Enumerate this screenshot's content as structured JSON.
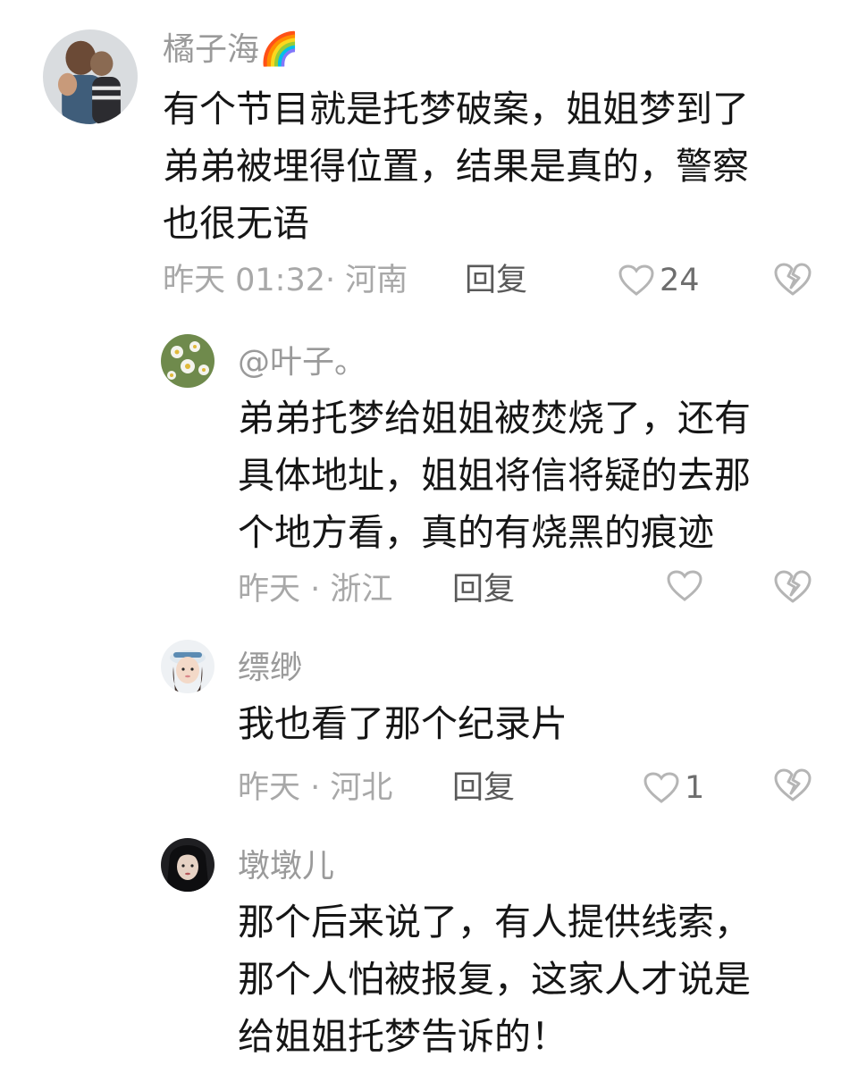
{
  "comments": [
    {
      "username": "橘子海",
      "emoji": "🌈",
      "lines": [
        "有个节目就是托梦破案，姐姐梦到了",
        "弟弟被埋得位置，结果是真的，警察",
        "也很无语"
      ],
      "meta": "昨天 01:32· 河南",
      "reply_label": "回复",
      "like_count": "24"
    },
    {
      "username": "@叶子。",
      "lines": [
        "弟弟托梦给姐姐被焚烧了，还有",
        "具体地址，姐姐将信将疑的去那",
        "个地方看，真的有烧黑的痕迹"
      ],
      "meta": "昨天 · 浙江",
      "reply_label": "回复",
      "like_count": ""
    },
    {
      "username": "缥缈",
      "lines": [
        "我也看了那个纪录片"
      ],
      "meta": "昨天 · 河北",
      "reply_label": "回复",
      "like_count": "1"
    },
    {
      "username": "墩墩儿",
      "lines": [
        "那个后来说了，有人提供线索，",
        "那个人怕被报复，这家人才说是",
        "给姐姐托梦告诉的！"
      ]
    }
  ],
  "colors": {
    "text": "#161616",
    "muted": "#9a9a9a",
    "reply": "#5a5a5a",
    "icon": "#b5b5b5"
  },
  "icons": [
    "heart-outline-icon",
    "broken-heart-icon"
  ]
}
